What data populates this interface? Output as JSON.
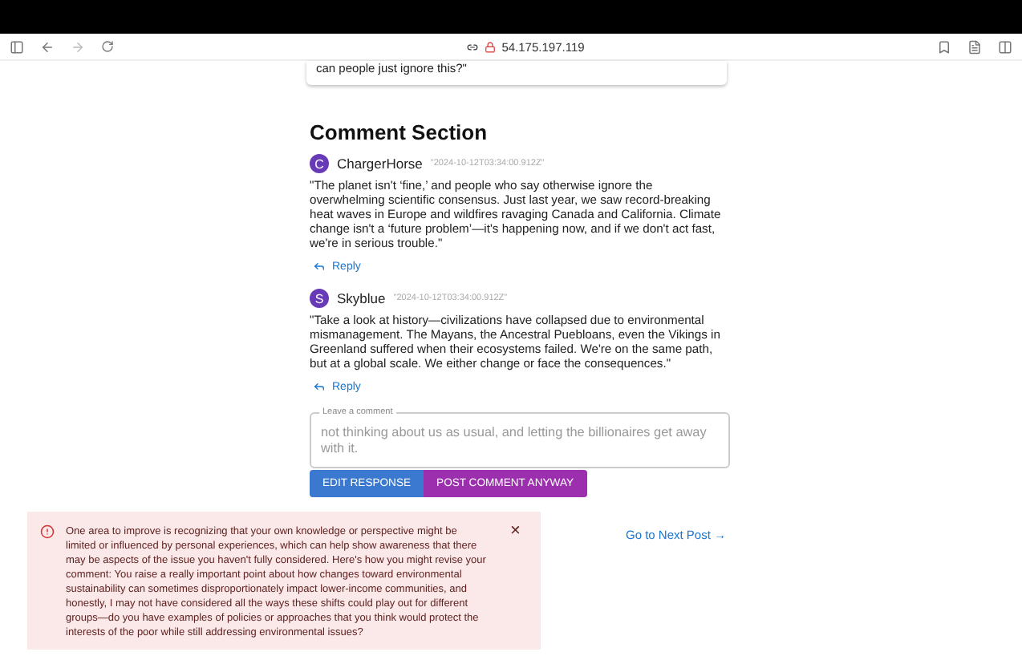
{
  "browser": {
    "address": "54.175.197.119"
  },
  "post_card": {
    "text_tail": "can people just ignore this?\""
  },
  "section_title": "Comment Section",
  "comments": [
    {
      "initial": "C",
      "author": "ChargerHorse",
      "timestamp": "\"2024-10-12T03:34:00.912Z\"",
      "text": "\"The planet isn't ‘fine,’ and people who say otherwise ignore the overwhelming scientific consensus. Just last year, we saw record-breaking heat waves in Europe and wildfires ravaging Canada and California. Climate change isn't a ‘future problem’—it's happening now, and if we don't act fast, we're in serious trouble.\"",
      "reply": "Reply"
    },
    {
      "initial": "S",
      "author": "Skyblue",
      "timestamp": "\"2024-10-12T03:34:00.912Z\"",
      "text": "\"Take a look at history—civilizations have collapsed due to environmental mismanagement. The Mayans, the Ancestral Puebloans, even the Vikings in Greenland suffered when their ecosystems failed. We're on the same path, but at a global scale. We either change or face the consequences.\"",
      "reply": "Reply"
    }
  ],
  "comment_field": {
    "label": "Leave a comment",
    "value": "not thinking about us as usual, and letting the billionaires get away with it."
  },
  "buttons": [
    {
      "label": "EDIT RESPONSE",
      "kind": "primary"
    },
    {
      "label": "POST COMMENT ANYWAY",
      "kind": "secondary"
    }
  ],
  "alert": {
    "text": "One area to improve is recognizing that your own knowledge or perspective might be limited or influenced by personal experiences, which can help show awareness that there may be aspects of the issue you haven't fully considered. Here's how you might revise your comment: You raise a really important point about how changes toward environmental sustainability can sometimes disproportionately impact lower-income communities, and honestly, I may not have considered all the ways these shifts could play out for different groups—do you have examples of policies or approaches that you think would protect the interests of the poor while still addressing environmental issues?",
    "close": "×"
  },
  "next_link": "Go to Next Post →"
}
